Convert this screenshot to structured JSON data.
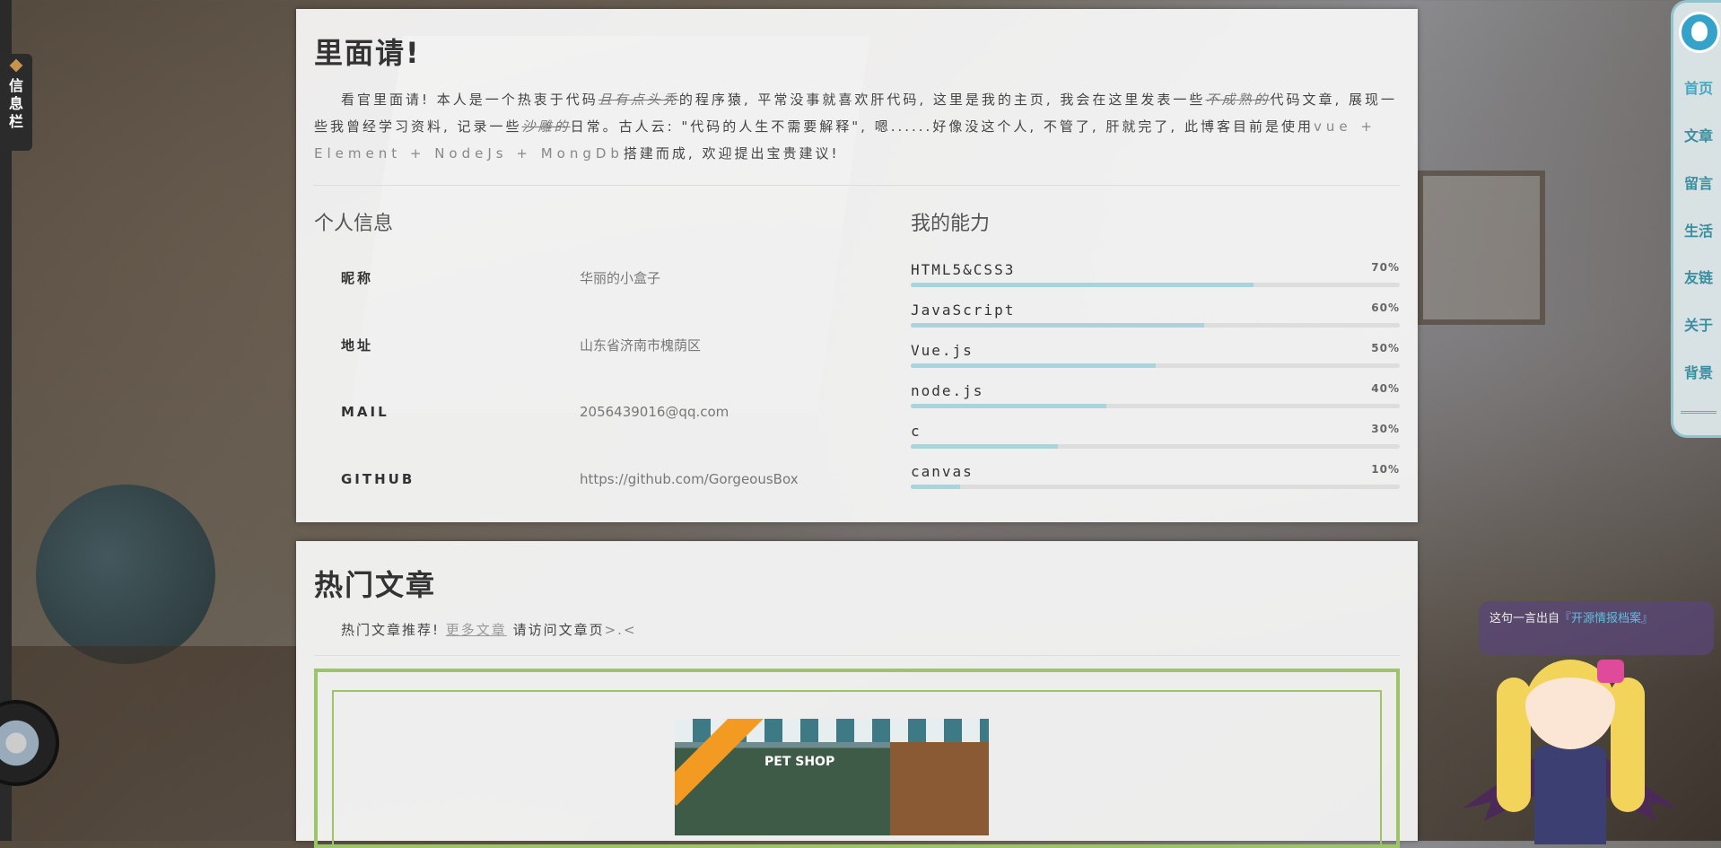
{
  "sidebar_tab": {
    "label": "信息栏"
  },
  "about": {
    "title": "里面请!",
    "intro": {
      "p1": "看官里面请! 本人是一个热衷于代码",
      "strike1": "且有点头秃",
      "p2": "的程序猿, 平常没事就喜欢肝代码, 这里是我的主页, 我会在这里发表一些",
      "strike2": "不成熟的",
      "p3": "代码文章, 展现一些我曾经学习资料, 记录一些",
      "strike3": "沙雕的",
      "p4": "日常。古人云: \"代码的人生不需要解释\", 嗯......好像没这个人, 不管了, 肝就完了, 此博客目前是使用",
      "tech": "vue + Element + NodeJs + MongDb",
      "p5": "搭建而成, 欢迎提出宝贵建议!"
    },
    "personal": {
      "title": "个人信息",
      "rows": [
        {
          "key": "昵称",
          "value": "华丽的小盒子"
        },
        {
          "key": "地址",
          "value": "山东省济南市槐荫区"
        },
        {
          "key": "MAIL",
          "value": "2056439016@qq.com"
        },
        {
          "key": "GITHUB",
          "value": "https://github.com/GorgeousBox"
        }
      ]
    },
    "skills": {
      "title": "我的能力",
      "items": [
        {
          "name": "HTML5&CSS3",
          "percent_label": "70%",
          "percent": 70
        },
        {
          "name": "JavaScript",
          "percent_label": "60%",
          "percent": 60
        },
        {
          "name": "Vue.js",
          "percent_label": "50%",
          "percent": 50
        },
        {
          "name": "node.js",
          "percent_label": "40%",
          "percent": 40
        },
        {
          "name": "c",
          "percent_label": "30%",
          "percent": 30
        },
        {
          "name": "canvas",
          "percent_label": "10%",
          "percent": 10
        }
      ]
    }
  },
  "hot": {
    "title": "热门文章",
    "sub_prefix": "热门文章推荐!",
    "more_link": "更多文章",
    "sub_suffix": "请访问文章页",
    "sub_tail": ">.<",
    "thumbnail_sign": "PET SHOP"
  },
  "right_nav": {
    "items": [
      "首页",
      "文章",
      "留言",
      "生活",
      "友链",
      "关于",
      "背景"
    ],
    "active_index": 0
  },
  "quote": {
    "prefix": "这句一言出自",
    "source": "『开源情报档案』"
  },
  "colors": {
    "skill_fill": "#a9d4dc",
    "nav_accent": "#3a8ea0",
    "frame_green": "#9ec46a"
  },
  "icons": [
    "cube-icon",
    "vinyl-disk-icon",
    "avatar-icon"
  ]
}
